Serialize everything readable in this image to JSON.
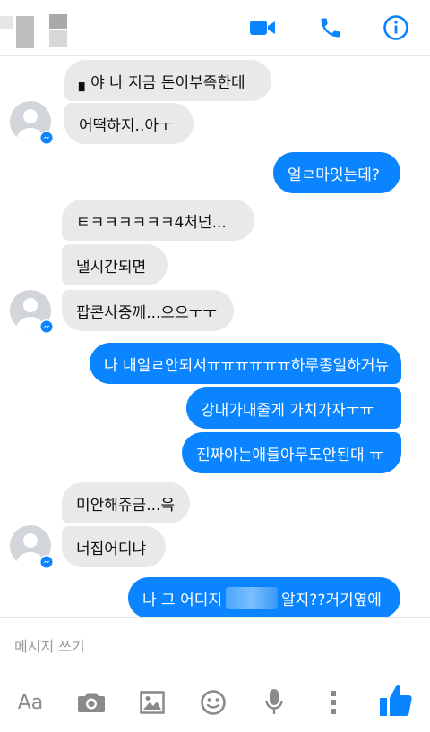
{
  "header": {
    "video_icon": "video-camera-icon",
    "phone_icon": "phone-icon",
    "info_icon": "info-icon",
    "accent_color": "#0a84ff"
  },
  "messages": [
    {
      "dir": "in",
      "text": "▖야 나 지금 돈이부족한데"
    },
    {
      "dir": "in",
      "text": "어떡하지..아ㅜ"
    },
    {
      "dir": "out",
      "text": "얼ㄹ마잇는데?"
    },
    {
      "dir": "in",
      "text": "ㅌㅋㅋㅋㅋㅋㅋ4처넌..."
    },
    {
      "dir": "in",
      "text": "낼시간되면"
    },
    {
      "dir": "in",
      "text": "팝콘사중께...으으ㅜㅜ"
    },
    {
      "dir": "out",
      "text": "나 내일ㄹ안되서ㅠㅠㅠㅠㅠㅠ하루종일하거뉴"
    },
    {
      "dir": "out",
      "text": "강내가내줄게 가치가자ㅜㅠ"
    },
    {
      "dir": "out",
      "text": "진짜아는애들아무도안된대 ㅠ"
    },
    {
      "dir": "in",
      "text": "미안해쥬금...윽"
    },
    {
      "dir": "in",
      "text": "너집어디냐"
    },
    {
      "dir": "out",
      "text_before": "나 그 어디지",
      "text_after": "알지??거기옆에"
    }
  ],
  "composer": {
    "placeholder": "메시지 쓰기",
    "aa_label": "Aa",
    "tools": [
      "camera-icon",
      "image-icon",
      "emoji-icon",
      "microphone-icon",
      "more-vertical-icon",
      "thumbs-up-icon"
    ]
  }
}
